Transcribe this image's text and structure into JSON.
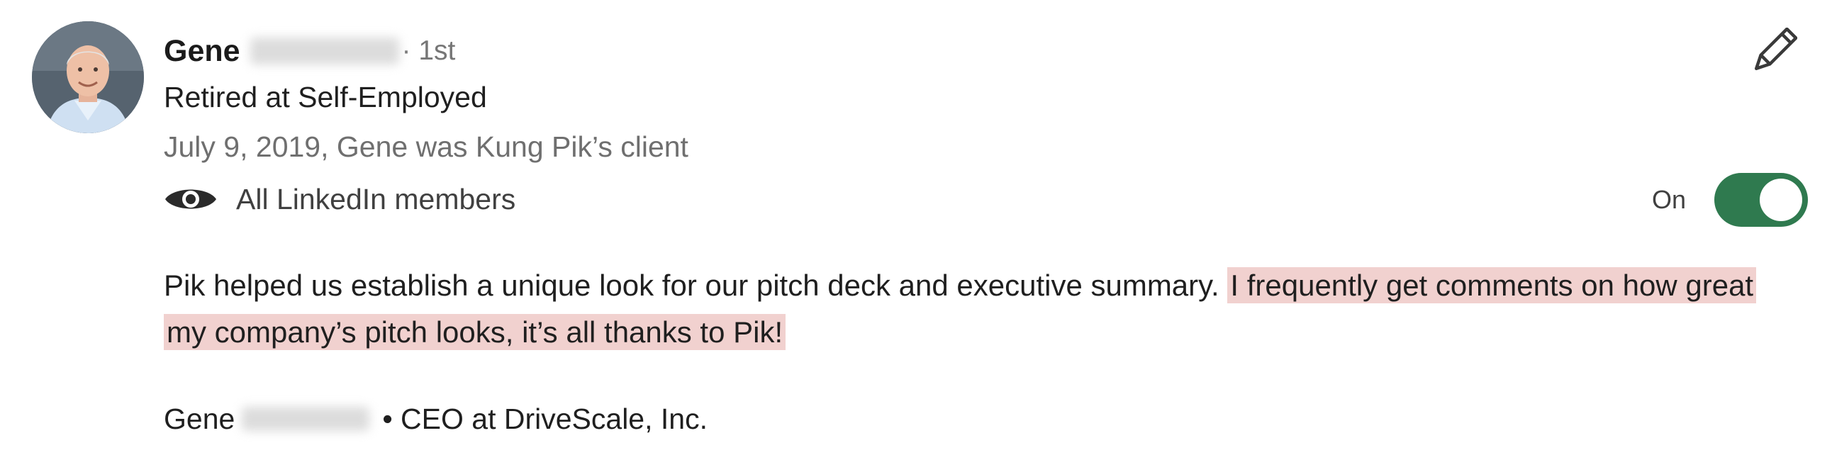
{
  "recommender": {
    "first_name": "Gene",
    "degree": "· 1st",
    "headline": "Retired at Self-Employed",
    "relationship": "July 9, 2019, Gene was Kung Pik’s client"
  },
  "visibility": {
    "icon": "eye-icon",
    "label": "All LinkedIn members"
  },
  "toggle": {
    "label": "On",
    "state": true,
    "color": "#2f7a4f"
  },
  "edit": {
    "icon": "pencil-icon"
  },
  "recommendation": {
    "text_plain": "Pik helped us establish a unique look for our pitch deck and executive summary. ",
    "text_highlighted": "I frequently get comments on how great my company’s pitch looks, it’s all thanks to Pik!",
    "highlight_color": "#f1d1cf"
  },
  "signature": {
    "first_name": "Gene",
    "title": "• CEO at DriveScale, Inc."
  }
}
